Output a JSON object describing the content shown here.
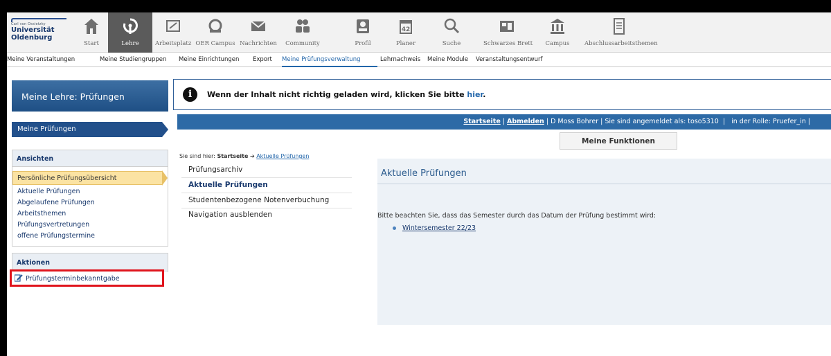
{
  "logo": {
    "small_text": "Carl von Ossietzky",
    "name_line1": "Universität",
    "name_line2": "Oldenburg"
  },
  "topnav": {
    "items": [
      {
        "label": "Start",
        "icon": "home-icon"
      },
      {
        "label": "Lehre",
        "icon": "lehre-icon",
        "active": true
      },
      {
        "label": "Arbeitsplatz",
        "icon": "workspace-icon"
      },
      {
        "label": "OER Campus",
        "icon": "oer-icon"
      },
      {
        "label": "Nachrichten",
        "icon": "mail-icon"
      },
      {
        "label": "Community",
        "icon": "community-icon"
      },
      {
        "label": "Profil",
        "icon": "profile-icon"
      },
      {
        "label": "Planer",
        "icon": "calendar-icon",
        "calendar_day": "42"
      },
      {
        "label": "Suche",
        "icon": "search-icon"
      },
      {
        "label": "Schwarzes Brett",
        "icon": "board-icon"
      },
      {
        "label": "Campus",
        "icon": "campus-icon"
      },
      {
        "label": "Abschlussarbeitsthemen",
        "icon": "document-icon"
      }
    ]
  },
  "subnav": {
    "items": [
      "Meine Veranstaltungen",
      "Meine Studiengruppen",
      "Meine Einrichtungen",
      "Export",
      "Meine Prüfungsverwaltung",
      "Lehrnachweis",
      "Meine Module",
      "Veranstaltungsentwurf"
    ],
    "active_index": 4
  },
  "sidebar": {
    "title": "Meine Lehre: Prüfungen",
    "current": "Meine Prüfungen",
    "views_header": "Ansichten",
    "views": [
      "Persönliche Prüfungsübersicht",
      "Aktuelle Prüfungen",
      "Abgelaufene Prüfungen",
      "Arbeitsthemen",
      "Prüfungsvertretungen",
      "offene Prüfungstermine"
    ],
    "actions_header": "Aktionen",
    "actions": [
      "Prüfungsterminbekanntgabe"
    ]
  },
  "banner": {
    "text": "Wenn der Inhalt nicht richtig geladen wird, klicken Sie bitte ",
    "link": "hier",
    "end": "."
  },
  "userbar": {
    "home": "Startseite",
    "logout": "Abmelden",
    "user": "D Moss Bohrer",
    "logged_in": "Sie sind angemeldet als: toso5310",
    "role": "in der Rolle: Pruefer_in"
  },
  "functions_button": "Meine Funktionen",
  "breadcrumb": {
    "prefix": "Sie sind hier:",
    "home": "Startseite",
    "arrow": "➔",
    "current": "Aktuelle Prüfungen"
  },
  "midnav": [
    "Prüfungsarchiv",
    "Aktuelle Prüfungen",
    "Studentenbezogene Notenverbuchung",
    "Navigation ausblenden"
  ],
  "content": {
    "title": "Aktuelle Prüfungen",
    "note": "Bitte beachten Sie, dass das Semester durch das Datum der Prüfung bestimmt wird:",
    "semesters": [
      "Wintersemester 22/23"
    ]
  },
  "colors": {
    "brand_blue": "#22508b",
    "highlight": "#fbe3a3",
    "annotation_red": "#e0141c"
  }
}
